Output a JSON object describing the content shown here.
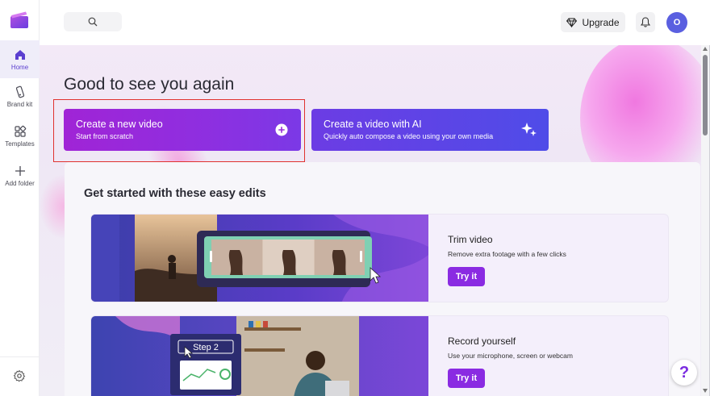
{
  "sidebar": {
    "items": [
      {
        "label": "Home",
        "icon": "home-icon"
      },
      {
        "label": "Brand kit",
        "icon": "brand-kit-icon"
      },
      {
        "label": "Templates",
        "icon": "templates-icon"
      },
      {
        "label": "Add folder",
        "icon": "plus-icon"
      }
    ],
    "settings_icon": "gear-icon"
  },
  "topbar": {
    "search_icon": "search-icon",
    "upgrade_label": "Upgrade",
    "upgrade_icon": "diamond-icon",
    "bell_icon": "bell-icon",
    "avatar_initial": "O"
  },
  "main": {
    "greeting": "Good to see you again",
    "cards": [
      {
        "title": "Create a new video",
        "subtitle": "Start from scratch",
        "icon": "plus-circle-icon"
      },
      {
        "title": "Create a video with AI",
        "subtitle": "Quickly auto compose a video using your own media",
        "icon": "sparkle-icon"
      }
    ],
    "easy_edits": {
      "heading": "Get started with these easy edits",
      "items": [
        {
          "title": "Trim video",
          "description": "Remove extra footage with a few clicks",
          "button": "Try it"
        },
        {
          "title": "Record yourself",
          "description": "Use your microphone, screen or webcam",
          "button": "Try it",
          "thumb_label": "Step 2"
        }
      ]
    }
  },
  "help_label": "?",
  "colors": {
    "accent": "#8a2be2",
    "card_new": "#a024d6",
    "card_ai": "#5a45e6",
    "highlight": "#e0322f"
  }
}
